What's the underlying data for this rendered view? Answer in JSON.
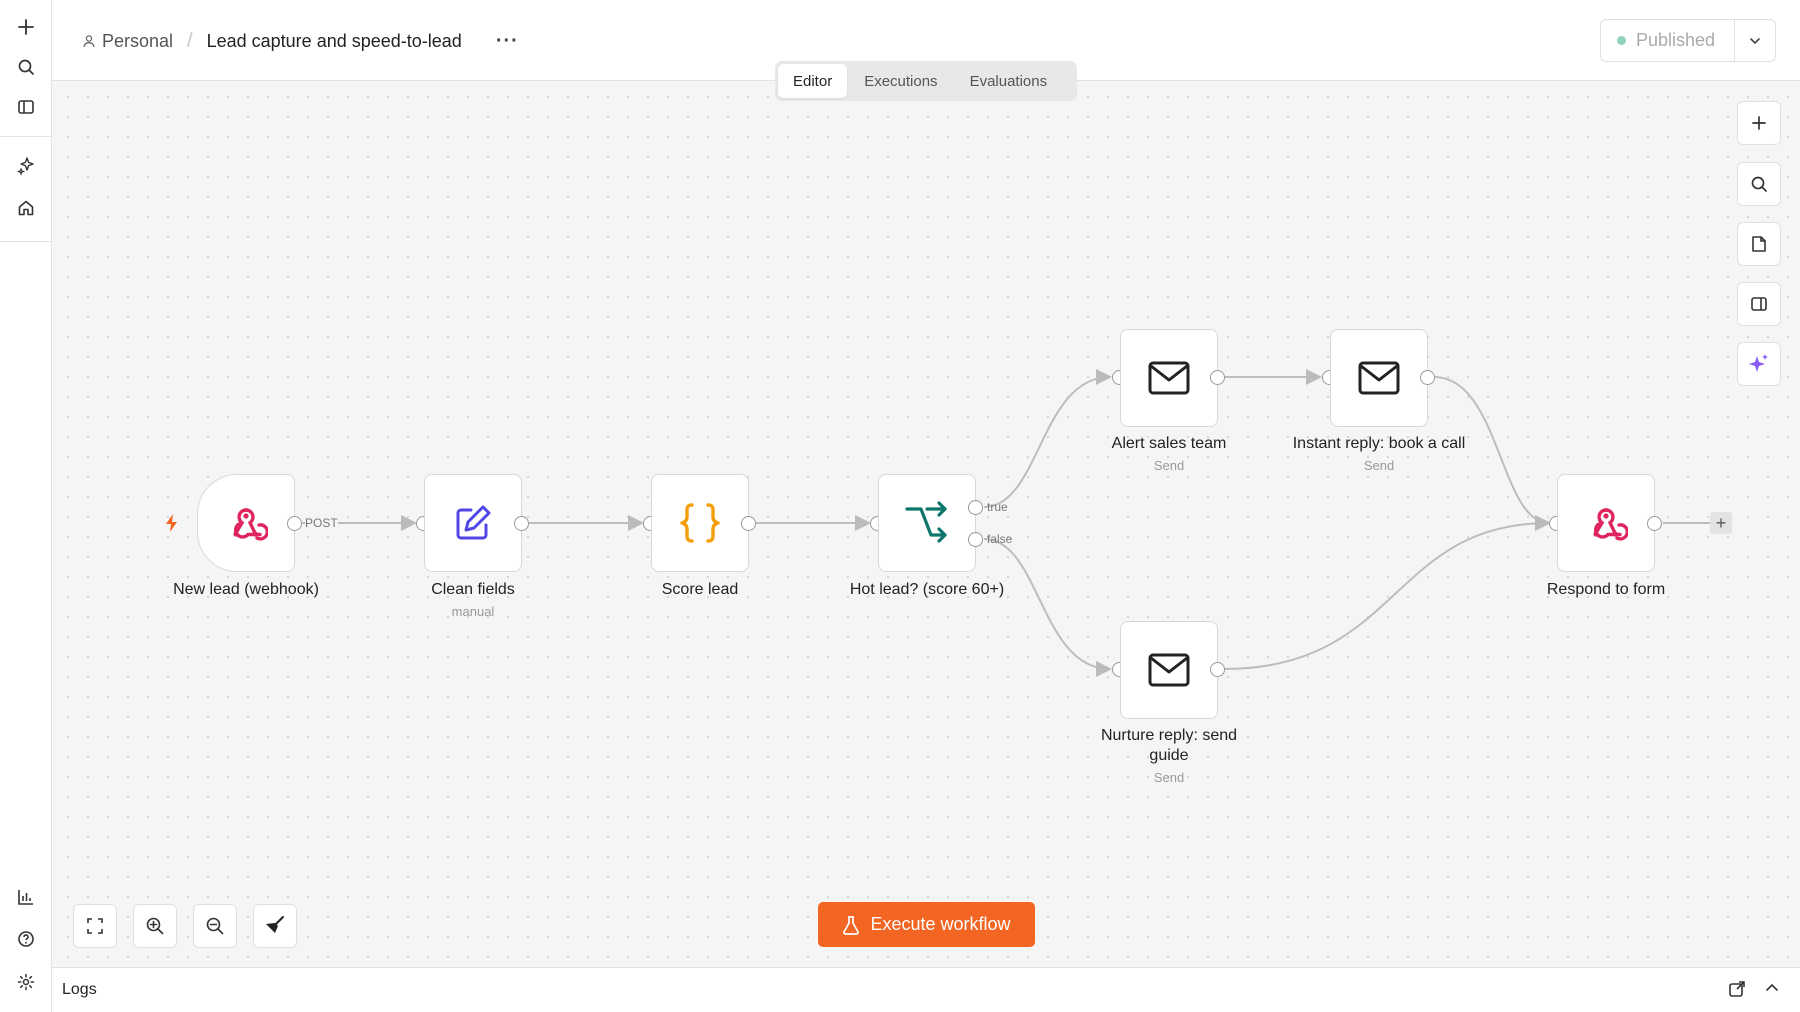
{
  "breadcrumb": {
    "project": "Personal",
    "workflow_name": "Lead capture and speed-to-lead"
  },
  "header": {
    "more_label": "···",
    "publish_status": "Published"
  },
  "tabs": [
    {
      "label": "Editor",
      "active": true
    },
    {
      "label": "Executions",
      "active": false
    },
    {
      "label": "Evaluations",
      "active": false
    }
  ],
  "nodes": {
    "webhook": {
      "label": "New lead (webhook)",
      "icon": "webhook-icon",
      "color": "#e0245e"
    },
    "clean": {
      "label": "Clean fields",
      "sub": "manual",
      "icon": "edit-icon",
      "color": "#4f46e5"
    },
    "score": {
      "label": "Score lead",
      "icon": "code-braces-icon",
      "color": "#f59e0b"
    },
    "iff": {
      "label": "Hot lead? (score 60+)",
      "icon": "branch-icon",
      "color": "#0f766e"
    },
    "alert": {
      "label": "Alert sales team",
      "sub": "Send",
      "icon": "mail-icon"
    },
    "instant": {
      "label": "Instant reply: book a call",
      "sub": "Send",
      "icon": "mail-icon"
    },
    "nurture": {
      "label": "Nurture reply: send guide",
      "sub": "Send",
      "icon": "mail-icon"
    },
    "respond": {
      "label": "Respond to form",
      "icon": "webhook-icon",
      "color": "#e0245e"
    }
  },
  "edge_labels": {
    "post": "POST",
    "true": "true",
    "false": "false"
  },
  "actions": {
    "execute_label": "Execute workflow",
    "add_node_label": "+"
  },
  "logs": {
    "title": "Logs"
  },
  "colors": {
    "accent": "#f26522",
    "trigger_bolt": "#f26522",
    "published_dot": "#8ed3c0",
    "ai_sparkle": "#8b5cf6"
  }
}
